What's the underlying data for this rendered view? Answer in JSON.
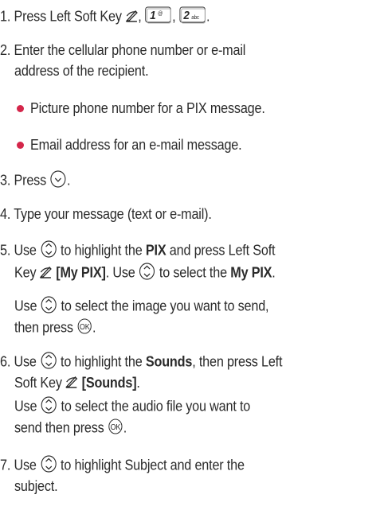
{
  "steps": [
    {
      "num": "1.",
      "a": "Press Left Soft Key",
      "sep1": ",",
      "sep2": ",",
      "end": ".",
      "key1": "1",
      "key1_sub": "@",
      "key2": "2",
      "key2_sub": "abc"
    },
    {
      "num": "2.",
      "l1": "Enter the cellular phone number or e-mail",
      "l2": "address of the recipient."
    },
    {
      "bullets": [
        "Picture phone number for a PIX message.",
        "Email address for an e-mail message."
      ]
    },
    {
      "num": "3.",
      "a": "Press",
      "end": "."
    },
    {
      "num": "4.",
      "l1": "Type your message (text or e-mail)."
    },
    {
      "num": "5.",
      "a": "Use",
      "b": "to highlight the",
      "c": "PIX",
      "d": "and press Left Soft",
      "e": "Key",
      "f": "[My PIX]",
      "g": ". Use",
      "h": "to select the",
      "i": "My PIX",
      "j": ".",
      "k": "Use",
      "l": "to select the image you want to send,",
      "m": "then press",
      "n": "."
    },
    {
      "num": "6.",
      "a": "Use",
      "b": "to highlight the",
      "c": "Sounds",
      "d": ", then press Left",
      "e": "Soft Key",
      "f": "[Sounds]",
      "g": ".",
      "h": "Use",
      "i": "to select the audio file you want to",
      "j": "send then press",
      "k": "."
    },
    {
      "num": "7.",
      "a": "Use",
      "b": "to highlight Subject and enter the",
      "c": "subject."
    }
  ],
  "icons": {
    "ok_label": "OK"
  },
  "colors": {
    "text": "#2b2b2b",
    "bullet": "#d4264a"
  }
}
